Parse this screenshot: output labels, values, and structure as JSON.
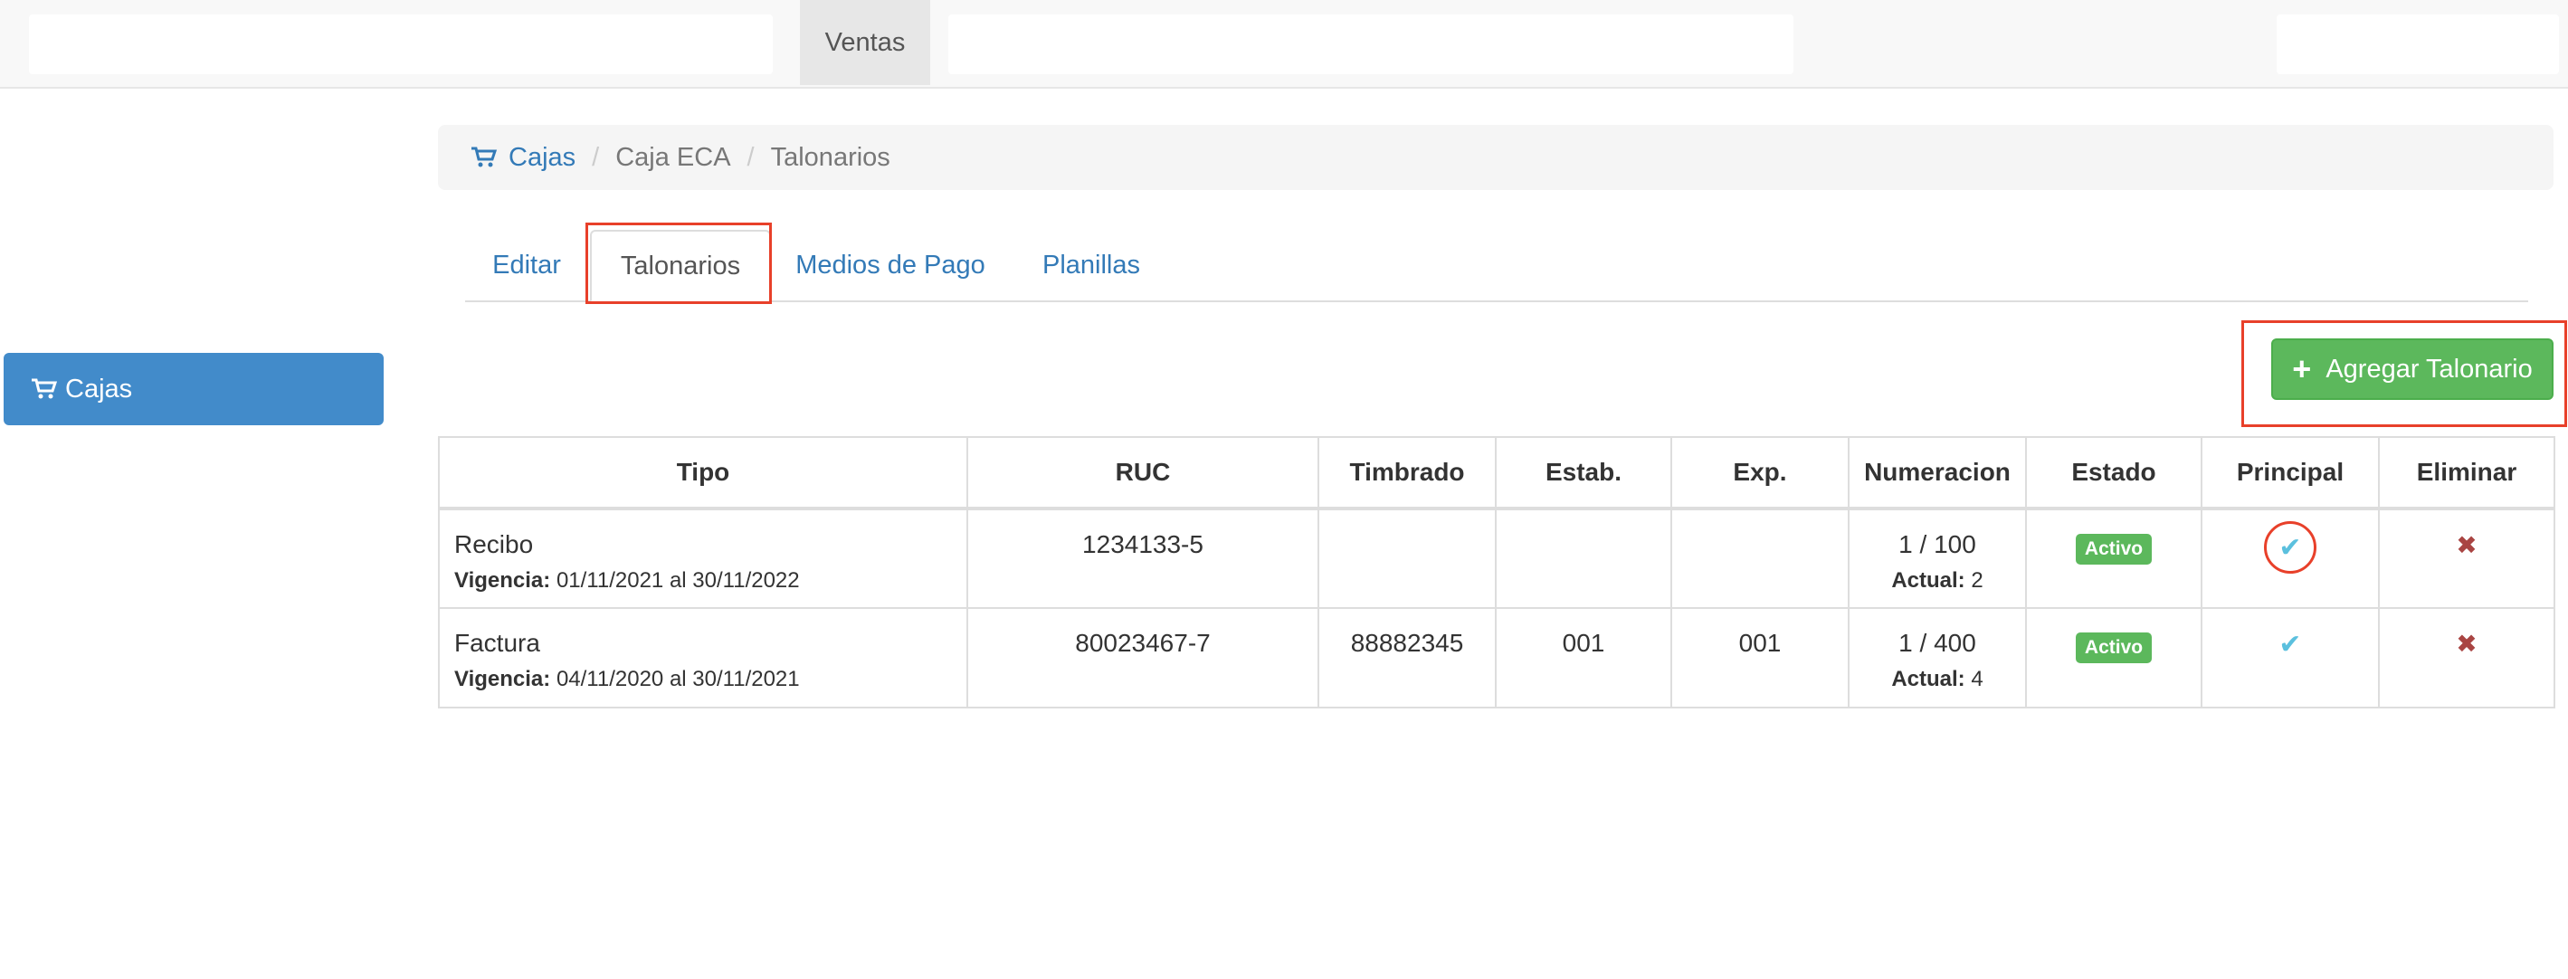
{
  "topnav": {
    "active_item": "Ventas"
  },
  "sidebar": {
    "item_label": "Cajas"
  },
  "breadcrumb": {
    "root": "Cajas",
    "level1": "Caja ECA",
    "current": "Talonarios"
  },
  "tabs": [
    "Editar",
    "Talonarios",
    "Medios de Pago",
    "Planillas"
  ],
  "active_tab": "Talonarios",
  "add_button": {
    "label": "Agregar Talonario"
  },
  "table": {
    "headers": [
      "Tipo",
      "RUC",
      "Timbrado",
      "Estab.",
      "Exp.",
      "Numeracion",
      "Estado",
      "Principal",
      "Eliminar"
    ],
    "vigencia_label": "Vigencia:",
    "actual_label": "Actual:",
    "rows": [
      {
        "tipo": "Recibo",
        "vigencia": "01/11/2021 al 30/11/2022",
        "ruc": "1234133-5",
        "timbrado": "",
        "estab": "",
        "exp": "",
        "numeracion": "1 / 100",
        "actual": "2",
        "estado": "Activo"
      },
      {
        "tipo": "Factura",
        "vigencia": "04/11/2020 al 30/11/2021",
        "ruc": "80023467-7",
        "timbrado": "88882345",
        "estab": "001",
        "exp": "001",
        "numeracion": "1 / 400",
        "actual": "4",
        "estado": "Activo"
      }
    ]
  },
  "colors": {
    "link": "#337ab7",
    "primary": "#428bca",
    "success": "#5cb85c",
    "info": "#5bc0de",
    "danger": "#a94442",
    "highlight": "#e8402a"
  },
  "icons": {
    "cart": "cart-icon",
    "plus": "plus-icon",
    "check": "check-icon",
    "remove": "remove-icon"
  }
}
